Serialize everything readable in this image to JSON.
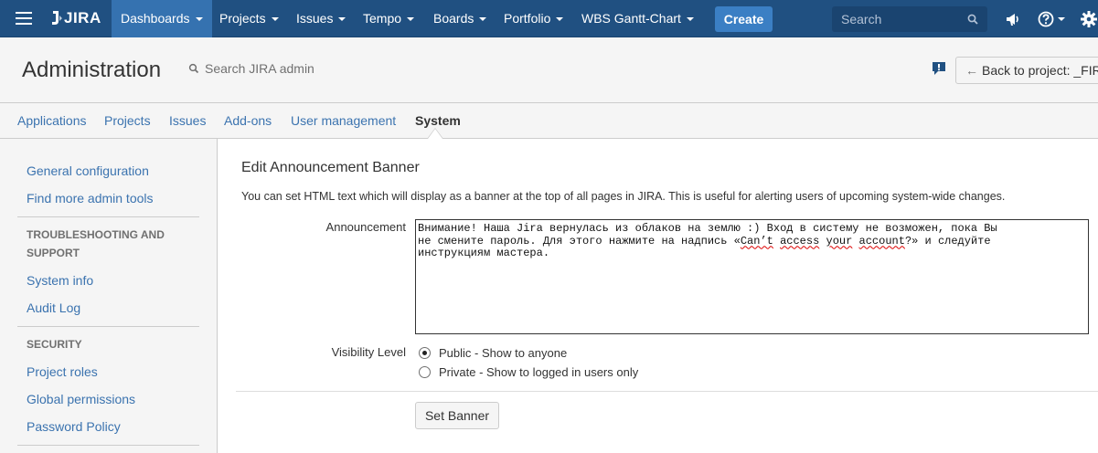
{
  "topnav": {
    "brand": "JIRA",
    "items": [
      {
        "label": "Dashboards"
      },
      {
        "label": "Projects"
      },
      {
        "label": "Issues"
      },
      {
        "label": "Tempo"
      },
      {
        "label": "Boards"
      },
      {
        "label": "Portfolio"
      },
      {
        "label": "WBS Gantt-Chart"
      }
    ],
    "create_label": "Create",
    "search_placeholder": "Search",
    "icons": [
      "menu-icon",
      "search-icon",
      "megaphone-icon",
      "help-icon",
      "gear-icon"
    ]
  },
  "admin": {
    "title": "Administration",
    "search_label": "Search JIRA admin",
    "back_label": "Back to project: _FIR"
  },
  "tabs": [
    {
      "label": "Applications"
    },
    {
      "label": "Projects"
    },
    {
      "label": "Issues"
    },
    {
      "label": "Add-ons"
    },
    {
      "label": "User management"
    },
    {
      "label": "System"
    }
  ],
  "sidebar": {
    "links_top": [
      "General configuration",
      "Find more admin tools"
    ],
    "section1": {
      "heading": "TROUBLESHOOTING AND SUPPORT",
      "links": [
        "System info",
        "Audit Log"
      ]
    },
    "section2": {
      "heading": "SECURITY",
      "links": [
        "Project roles",
        "Global permissions",
        "Password Policy"
      ]
    }
  },
  "main": {
    "title": "Edit Announcement Banner",
    "description": "You can set HTML text which will display as a banner at the top of all pages in JIRA. This is useful for alerting users of upcoming system-wide changes.",
    "announcement_label": "Announcement",
    "announcement_parts": [
      "Внимание! Наша Jira вернулась из облаков на землю :) Вход в систему не возможен, пока Вы\nне смените пароль. Для этого нажмите на надпись «",
      "Can’t",
      " ",
      "access",
      " ",
      "your",
      " ",
      "account",
      "?» и следуйте\nинструкциям мастера."
    ],
    "visibility_label": "Visibility Level",
    "visibility_options": [
      {
        "label": "Public - Show to anyone",
        "selected": true
      },
      {
        "label": "Private - Show to logged in users only",
        "selected": false
      }
    ],
    "submit_label": "Set Banner"
  }
}
